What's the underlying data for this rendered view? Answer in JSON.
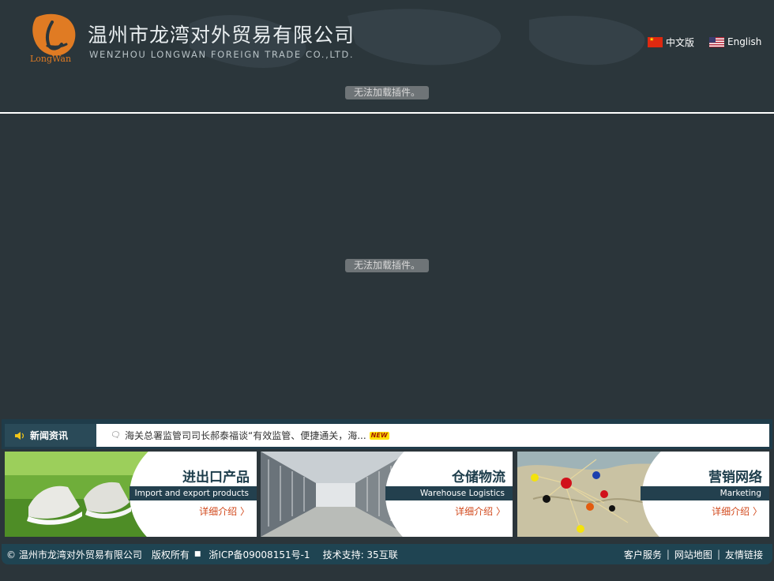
{
  "header": {
    "logo_text": "LongWan",
    "company_name_cn": "温州市龙湾对外贸易有限公司",
    "company_name_en": "WENZHOU LONGWAN FOREIGN TRADE CO.,LTD.",
    "languages": [
      {
        "label": "中文版",
        "icon": "china-flag-icon"
      },
      {
        "label": "English",
        "icon": "us-flag-icon"
      }
    ]
  },
  "plugins": {
    "message_1": "无法加载插件。",
    "message_2": "无法加载插件。"
  },
  "news": {
    "label": "新闻资讯",
    "item": "海关总署监管司司长郝泰福谈“有效监管、便捷通关，海...",
    "badge": "NEW"
  },
  "panels": [
    {
      "title": "进出口产品",
      "subtitle": "Import and export products",
      "more": "详细介绍 〉"
    },
    {
      "title": "仓储物流",
      "subtitle": "Warehouse Logistics",
      "more": "详细介绍 〉"
    },
    {
      "title": "营销网络",
      "subtitle": "Marketing",
      "more": "详细介绍 〉"
    }
  ],
  "footer": {
    "copyright": "© 温州市龙湾对外贸易有限公司",
    "rights": "版权所有",
    "square": "■",
    "icp": "浙ICP备09008151号-1",
    "support": "技术支持: 35互联",
    "links": [
      "客户服务",
      "网站地图",
      "友情链接"
    ],
    "separator": "|"
  },
  "colors": {
    "background": "#2b353a",
    "accent_orange": "#e07b23",
    "panel_navy": "#23404e",
    "more_link": "#d24a1d"
  }
}
